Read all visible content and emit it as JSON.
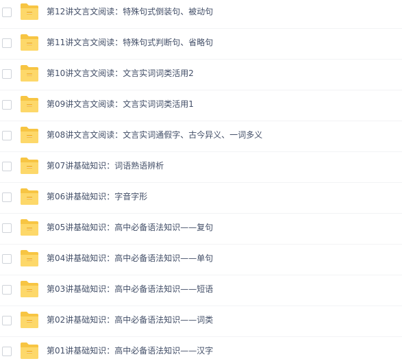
{
  "colors": {
    "folder_back": "#f7c543",
    "folder_front": "#fdd86a",
    "folder_tab": "#f3b93a",
    "text": "#424e67",
    "divider": "#f2f3f5",
    "checkbox_border": "#cfd3d9"
  },
  "icons": {
    "row_icon": "folder-icon"
  },
  "files": [
    {
      "name": "第12讲文言文阅读：特殊句式倒装句、被动句"
    },
    {
      "name": "第11讲文言文阅读：特殊句式判断句、省略句"
    },
    {
      "name": "第10讲文言文阅读：文言实词词类活用2"
    },
    {
      "name": "第09讲文言文阅读：文言实词词类活用1"
    },
    {
      "name": "第08讲文言文阅读：文言实词通假字、古今异义、一词多义"
    },
    {
      "name": "第07讲基础知识：词语熟语辨析"
    },
    {
      "name": "第06讲基础知识：字音字形"
    },
    {
      "name": "第05讲基础知识：高中必备语法知识——复句"
    },
    {
      "name": "第04讲基础知识：高中必备语法知识——单句"
    },
    {
      "name": "第03讲基础知识：高中必备语法知识——短语"
    },
    {
      "name": "第02讲基础知识：高中必备语法知识——词类"
    },
    {
      "name": "第01讲基础知识：高中必备语法知识——汉字"
    }
  ]
}
